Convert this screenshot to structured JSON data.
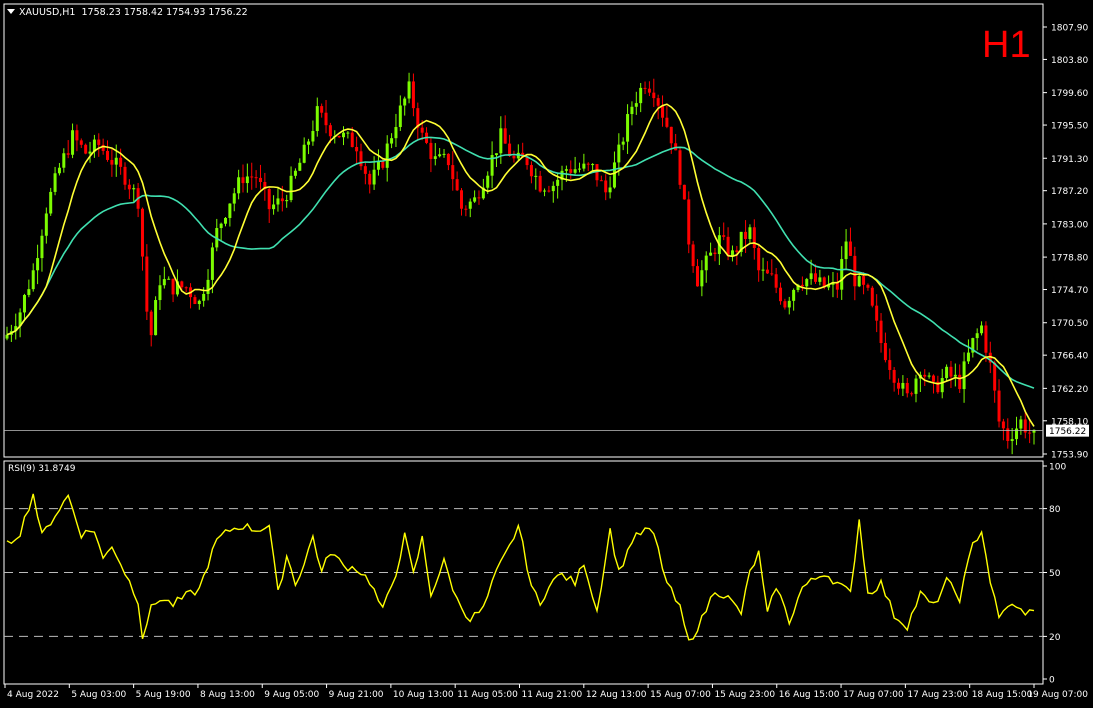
{
  "header": {
    "symbol": "XAUUSD,H1",
    "ohlc": "1758.23 1758.42 1754.93 1756.22",
    "timeframe": "H1"
  },
  "price_axis": {
    "ticks": [
      "1807.90",
      "1803.80",
      "1799.60",
      "1795.50",
      "1791.30",
      "1787.20",
      "1783.00",
      "1778.80",
      "1774.70",
      "1770.50",
      "1766.40",
      "1762.20",
      "1758.10",
      "1753.90"
    ],
    "current": "1756.22"
  },
  "rsi": {
    "label": "RSI(9) 31.8749",
    "ticks": [
      "100",
      "80",
      "50",
      "20",
      "0"
    ],
    "levels": [
      80,
      50,
      20
    ]
  },
  "time_axis": {
    "labels": [
      "4 Aug 2022",
      "5 Aug 03:00",
      "5 Aug 19:00",
      "8 Aug 13:00",
      "9 Aug 05:00",
      "9 Aug 21:00",
      "10 Aug 13:00",
      "11 Aug 05:00",
      "11 Aug 21:00",
      "12 Aug 13:00",
      "15 Aug 07:00",
      "15 Aug 23:00",
      "16 Aug 15:00",
      "17 Aug 07:00",
      "17 Aug 23:00",
      "18 Aug 15:00",
      "19 Aug 07:00"
    ]
  },
  "colors": {
    "bull": "#7cfc00",
    "bear": "#ff0000",
    "ma_fast": "#ffff33",
    "ma_slow": "#40e0b0",
    "rsi": "#ffff00",
    "bg": "#000000",
    "grid": "#ffffff"
  },
  "chart_data": [
    {
      "type": "candlestick",
      "title": "XAUUSD,H1",
      "ylim": [
        1753.5,
        1809.5
      ],
      "close_anchors": [
        [
          0,
          1769
        ],
        [
          3,
          1772
        ],
        [
          6,
          1777
        ],
        [
          9,
          1785
        ],
        [
          12,
          1790
        ],
        [
          15,
          1794
        ],
        [
          18,
          1792
        ],
        [
          21,
          1793
        ],
        [
          24,
          1791
        ],
        [
          27,
          1789
        ],
        [
          30,
          1786
        ],
        [
          32,
          1772
        ],
        [
          33,
          1769
        ],
        [
          35,
          1776
        ],
        [
          38,
          1775
        ],
        [
          41,
          1775
        ],
        [
          44,
          1773
        ],
        [
          46,
          1777
        ],
        [
          48,
          1782
        ],
        [
          51,
          1786
        ],
        [
          54,
          1789
        ],
        [
          57,
          1789
        ],
        [
          60,
          1785
        ],
        [
          63,
          1786
        ],
        [
          65,
          1788
        ],
        [
          68,
          1792
        ],
        [
          71,
          1797
        ],
        [
          74,
          1795
        ],
        [
          77,
          1794
        ],
        [
          80,
          1793
        ],
        [
          83,
          1788
        ],
        [
          86,
          1791
        ],
        [
          89,
          1796
        ],
        [
          92,
          1800
        ],
        [
          95,
          1794
        ],
        [
          98,
          1791
        ],
        [
          101,
          1791
        ],
        [
          104,
          1785
        ],
        [
          107,
          1786
        ],
        [
          110,
          1790
        ],
        [
          113,
          1794
        ],
        [
          116,
          1791
        ],
        [
          119,
          1791
        ],
        [
          122,
          1788
        ],
        [
          125,
          1788
        ],
        [
          128,
          1790
        ],
        [
          131,
          1790
        ],
        [
          134,
          1790
        ],
        [
          137,
          1787
        ],
        [
          140,
          1792
        ],
        [
          143,
          1798
        ],
        [
          146,
          1801
        ],
        [
          148,
          1800
        ],
        [
          150,
          1797
        ],
        [
          152,
          1794
        ],
        [
          154,
          1789
        ],
        [
          156,
          1781
        ],
        [
          158,
          1776
        ],
        [
          160,
          1778
        ],
        [
          163,
          1781
        ],
        [
          166,
          1779
        ],
        [
          168,
          1781
        ],
        [
          170,
          1782
        ],
        [
          172,
          1777
        ],
        [
          175,
          1776
        ],
        [
          178,
          1773
        ],
        [
          181,
          1776
        ],
        [
          184,
          1776
        ],
        [
          187,
          1775
        ],
        [
          190,
          1775
        ],
        [
          192,
          1781
        ],
        [
          194,
          1776
        ],
        [
          197,
          1774
        ],
        [
          200,
          1768
        ],
        [
          203,
          1764
        ],
        [
          206,
          1761
        ],
        [
          209,
          1765
        ],
        [
          212,
          1762
        ],
        [
          215,
          1764
        ],
        [
          218,
          1763
        ],
        [
          221,
          1768
        ],
        [
          223,
          1770
        ],
        [
          225,
          1765
        ],
        [
          227,
          1758
        ],
        [
          229,
          1756
        ],
        [
          232,
          1758
        ],
        [
          235,
          1756
        ]
      ],
      "ma_fast": "yellow",
      "ma_slow": "green"
    },
    {
      "type": "line",
      "name": "RSI(9)",
      "ylim": [
        0,
        100
      ],
      "value_anchors": [
        [
          0,
          63
        ],
        [
          3,
          69
        ],
        [
          6,
          87
        ],
        [
          8,
          67
        ],
        [
          10,
          74
        ],
        [
          12,
          80
        ],
        [
          14,
          86
        ],
        [
          17,
          68
        ],
        [
          20,
          70
        ],
        [
          22,
          56
        ],
        [
          24,
          63
        ],
        [
          27,
          50
        ],
        [
          30,
          37
        ],
        [
          31,
          20
        ],
        [
          33,
          33
        ],
        [
          35,
          38
        ],
        [
          38,
          35
        ],
        [
          41,
          39
        ],
        [
          44,
          42
        ],
        [
          46,
          54
        ],
        [
          48,
          65
        ],
        [
          51,
          70
        ],
        [
          54,
          72
        ],
        [
          57,
          70
        ],
        [
          60,
          72
        ],
        [
          62,
          40
        ],
        [
          64,
          58
        ],
        [
          66,
          45
        ],
        [
          68,
          54
        ],
        [
          70,
          67
        ],
        [
          72,
          50
        ],
        [
          74,
          60
        ],
        [
          77,
          53
        ],
        [
          80,
          52
        ],
        [
          83,
          46
        ],
        [
          86,
          32
        ],
        [
          89,
          50
        ],
        [
          91,
          67
        ],
        [
          93,
          49
        ],
        [
          95,
          66
        ],
        [
          97,
          40
        ],
        [
          100,
          55
        ],
        [
          103,
          37
        ],
        [
          106,
          28
        ],
        [
          109,
          33
        ],
        [
          112,
          50
        ],
        [
          115,
          62
        ],
        [
          117,
          72
        ],
        [
          120,
          44
        ],
        [
          122,
          34
        ],
        [
          124,
          45
        ],
        [
          127,
          49
        ],
        [
          130,
          45
        ],
        [
          132,
          55
        ],
        [
          135,
          32
        ],
        [
          138,
          70
        ],
        [
          140,
          50
        ],
        [
          143,
          65
        ],
        [
          146,
          70
        ],
        [
          148,
          68
        ],
        [
          151,
          45
        ],
        [
          154,
          33
        ],
        [
          156,
          17
        ],
        [
          159,
          28
        ],
        [
          162,
          42
        ],
        [
          165,
          38
        ],
        [
          168,
          31
        ],
        [
          170,
          50
        ],
        [
          172,
          59
        ],
        [
          174,
          30
        ],
        [
          176,
          44
        ],
        [
          179,
          27
        ],
        [
          182,
          43
        ],
        [
          185,
          47
        ],
        [
          187,
          50
        ],
        [
          190,
          45
        ],
        [
          193,
          40
        ],
        [
          195,
          75
        ],
        [
          197,
          40
        ],
        [
          200,
          45
        ],
        [
          203,
          30
        ],
        [
          206,
          25
        ],
        [
          209,
          40
        ],
        [
          212,
          34
        ],
        [
          215,
          46
        ],
        [
          218,
          38
        ],
        [
          221,
          63
        ],
        [
          223,
          70
        ],
        [
          225,
          46
        ],
        [
          227,
          28
        ],
        [
          229,
          35
        ],
        [
          232,
          32
        ],
        [
          235,
          31
        ]
      ]
    }
  ]
}
